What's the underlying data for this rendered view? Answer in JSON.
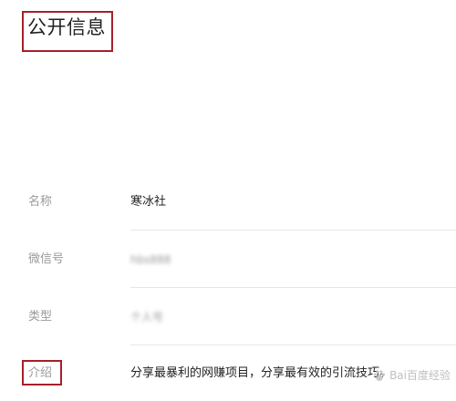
{
  "section": {
    "title": "公开信息"
  },
  "rows": [
    {
      "label": "名称",
      "value": "寒冰社"
    },
    {
      "label": "微信号",
      "value": "hbs888"
    },
    {
      "label": "类型",
      "value": "个人号"
    },
    {
      "label": "介绍",
      "value": "分享最暴利的网赚项目，分享最有效的引流技巧。"
    }
  ],
  "watermark": {
    "text": "Bai百度经验"
  },
  "colors": {
    "highlight": "#a5202a",
    "label": "#9a9a9a",
    "value": "#222222",
    "divider": "#e6e6e6"
  }
}
